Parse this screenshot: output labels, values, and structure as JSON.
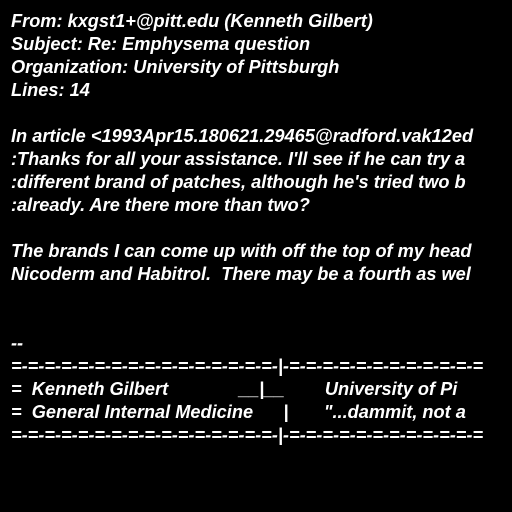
{
  "colors": {
    "background": "#000000",
    "text": "#ffffff"
  },
  "header": {
    "from": "From: kxgst1+@pitt.edu (Kenneth Gilbert)",
    "subject": "Subject: Re: Emphysema question",
    "organization": "Organization: University of Pittsburgh",
    "lines": "Lines: 14"
  },
  "body": {
    "attribution": "In article <1993Apr15.180621.29465@radford.vak12ed",
    "quote": [
      ":Thanks for all your assistance. I'll see if he can try a",
      ":different brand of patches, although he's tried two b",
      ":already. Are there more than two?"
    ],
    "reply": [
      "The brands I can come up with off the top of my head",
      "Nicoderm and Habitrol.  There may be a fourth as wel"
    ]
  },
  "signature": {
    "delimiter": "--",
    "rule_top": "=-=-=-=-=-=-=-=-=-=-=-=-=-=-=-=-|-=-=-=-=-=-=-=-=-=-=-=-=",
    "line1": "=  Kenneth Gilbert              __|__        University of Pi",
    "line2": "=  General Internal Medicine      |       \"...dammit, not a",
    "rule_bottom": "=-=-=-=-=-=-=-=-=-=-=-=-=-=-=-=-|-=-=-=-=-=-=-=-=-=-=-=-="
  }
}
